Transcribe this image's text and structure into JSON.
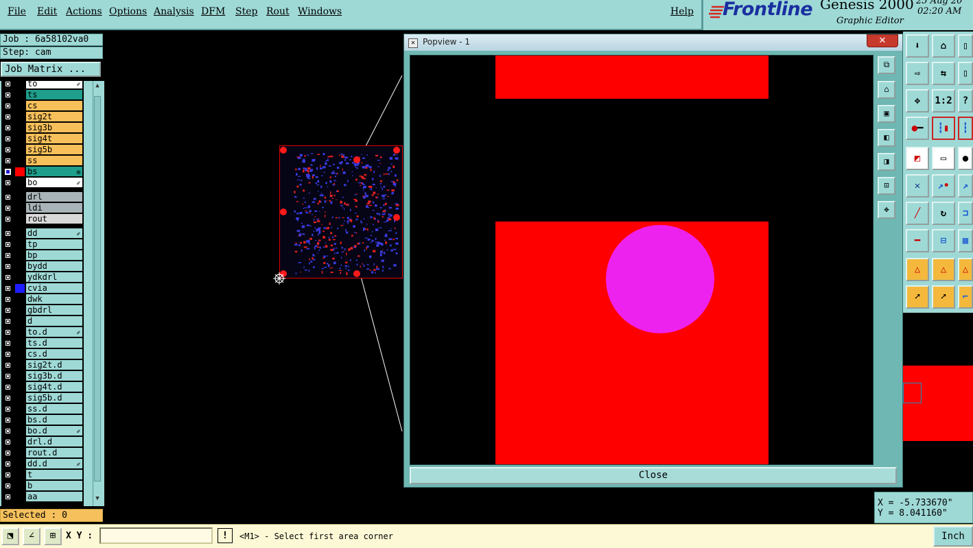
{
  "menu": [
    "File",
    "Edit",
    "Actions",
    "Options",
    "Analysis",
    "DFM",
    "Step",
    "Rout",
    "Windows"
  ],
  "help": "Help",
  "brand": {
    "logo": "Frontline",
    "product": "Genesis 2000",
    "subtitle": "Graphic Editor",
    "date": "25 Aug 20",
    "time": "02:20 AM"
  },
  "job": {
    "job_label": "Job : 6a58102va0",
    "step_label": "Step: cam",
    "matrix_button": "Job Matrix ..."
  },
  "colors": {
    "panel": "#9ed9d6",
    "layer_teal": "#1f9e8c",
    "layer_orange": "#f8c05a",
    "layer_grey": "#a8b4b8",
    "layer_light": "#d9d9d9",
    "pad_red": "#ff0000",
    "pad_magenta": "#ee22ee"
  },
  "layers": [
    {
      "name": "to",
      "bg": "#ffffff",
      "mark": "✐"
    },
    {
      "name": "ts",
      "bg": "#1f9e8c"
    },
    {
      "name": "cs",
      "bg": "#f8c05a"
    },
    {
      "name": "sig2t",
      "bg": "#f8c05a"
    },
    {
      "name": "sig3b",
      "bg": "#f8c05a"
    },
    {
      "name": "sig4t",
      "bg": "#f8c05a"
    },
    {
      "name": "sig5b",
      "bg": "#f8c05a"
    },
    {
      "name": "ss",
      "bg": "#f8c05a"
    },
    {
      "name": "bs",
      "bg": "#1f9e8c",
      "swatch": "#ff0000",
      "selected": true,
      "mark": "⊞"
    },
    {
      "name": "bo",
      "bg": "#ffffff",
      "mark": "✐"
    },
    {
      "name": "drl",
      "bg": "#a8b4b8",
      "gap": true
    },
    {
      "name": "ldi",
      "bg": "#a8b4b8"
    },
    {
      "name": "rout",
      "bg": "#d9d9d9"
    },
    {
      "name": "dd",
      "bg": "#9ed9d6",
      "gap": true,
      "mark": "✐"
    },
    {
      "name": "tp",
      "bg": "#9ed9d6"
    },
    {
      "name": "bp",
      "bg": "#9ed9d6"
    },
    {
      "name": "bydd",
      "bg": "#9ed9d6"
    },
    {
      "name": "ydkdrl",
      "bg": "#9ed9d6"
    },
    {
      "name": "cvia",
      "bg": "#9ed9d6",
      "swatch": "#1d1dff"
    },
    {
      "name": "dwk",
      "bg": "#9ed9d6"
    },
    {
      "name": "gbdrl",
      "bg": "#9ed9d6"
    },
    {
      "name": "d",
      "bg": "#9ed9d6"
    },
    {
      "name": "to.d",
      "bg": "#9ed9d6",
      "mark": "✐"
    },
    {
      "name": "ts.d",
      "bg": "#9ed9d6"
    },
    {
      "name": "cs.d",
      "bg": "#9ed9d6"
    },
    {
      "name": "sig2t.d",
      "bg": "#9ed9d6"
    },
    {
      "name": "sig3b.d",
      "bg": "#9ed9d6"
    },
    {
      "name": "sig4t.d",
      "bg": "#9ed9d6"
    },
    {
      "name": "sig5b.d",
      "bg": "#9ed9d6"
    },
    {
      "name": "ss.d",
      "bg": "#9ed9d6"
    },
    {
      "name": "bs.d",
      "bg": "#9ed9d6"
    },
    {
      "name": "bo.d",
      "bg": "#9ed9d6",
      "mark": "✐"
    },
    {
      "name": "drl.d",
      "bg": "#9ed9d6"
    },
    {
      "name": "rout.d",
      "bg": "#9ed9d6"
    },
    {
      "name": "dd.d",
      "bg": "#9ed9d6",
      "mark": "✐"
    },
    {
      "name": "t",
      "bg": "#9ed9d6"
    },
    {
      "name": "b",
      "bg": "#9ed9d6"
    },
    {
      "name": "aa",
      "bg": "#9ed9d6"
    }
  ],
  "selected_label": "Selected : 0",
  "popview": {
    "title": "Popview - 1",
    "close_x": "✕",
    "close_button": "Close",
    "tool_icons": [
      "zoom-fit-icon",
      "zoom-home-icon",
      "zoom-in-icon",
      "zoom-out-icon",
      "pan-icon",
      "zoom-area-icon",
      "center-icon"
    ]
  },
  "right_tools": {
    "icons": [
      "zoom-in",
      "home",
      "pan",
      "zoom-out",
      "back",
      "next",
      "center",
      "1:2",
      "help",
      "snap",
      "layer-sel",
      "layer-2",
      "draw-line",
      "ruler",
      "round",
      "cross",
      "arrow-add",
      "add-2",
      "line-red",
      "arc",
      "edge",
      "measure",
      "component",
      "pad",
      "polygon-a",
      "polygon-b",
      "triangle",
      "select-arrow",
      "select-arrow-2",
      "route"
    ],
    "text_1_2": "1:2",
    "text_help": "?"
  },
  "coords": {
    "x": "X = -5.733670\"",
    "y": "Y = 8.041160\""
  },
  "status": {
    "xy_label": "X Y :",
    "xy_value": "",
    "warn": "!",
    "message": "<M1> - Select first area corner",
    "unit": "Inch"
  }
}
